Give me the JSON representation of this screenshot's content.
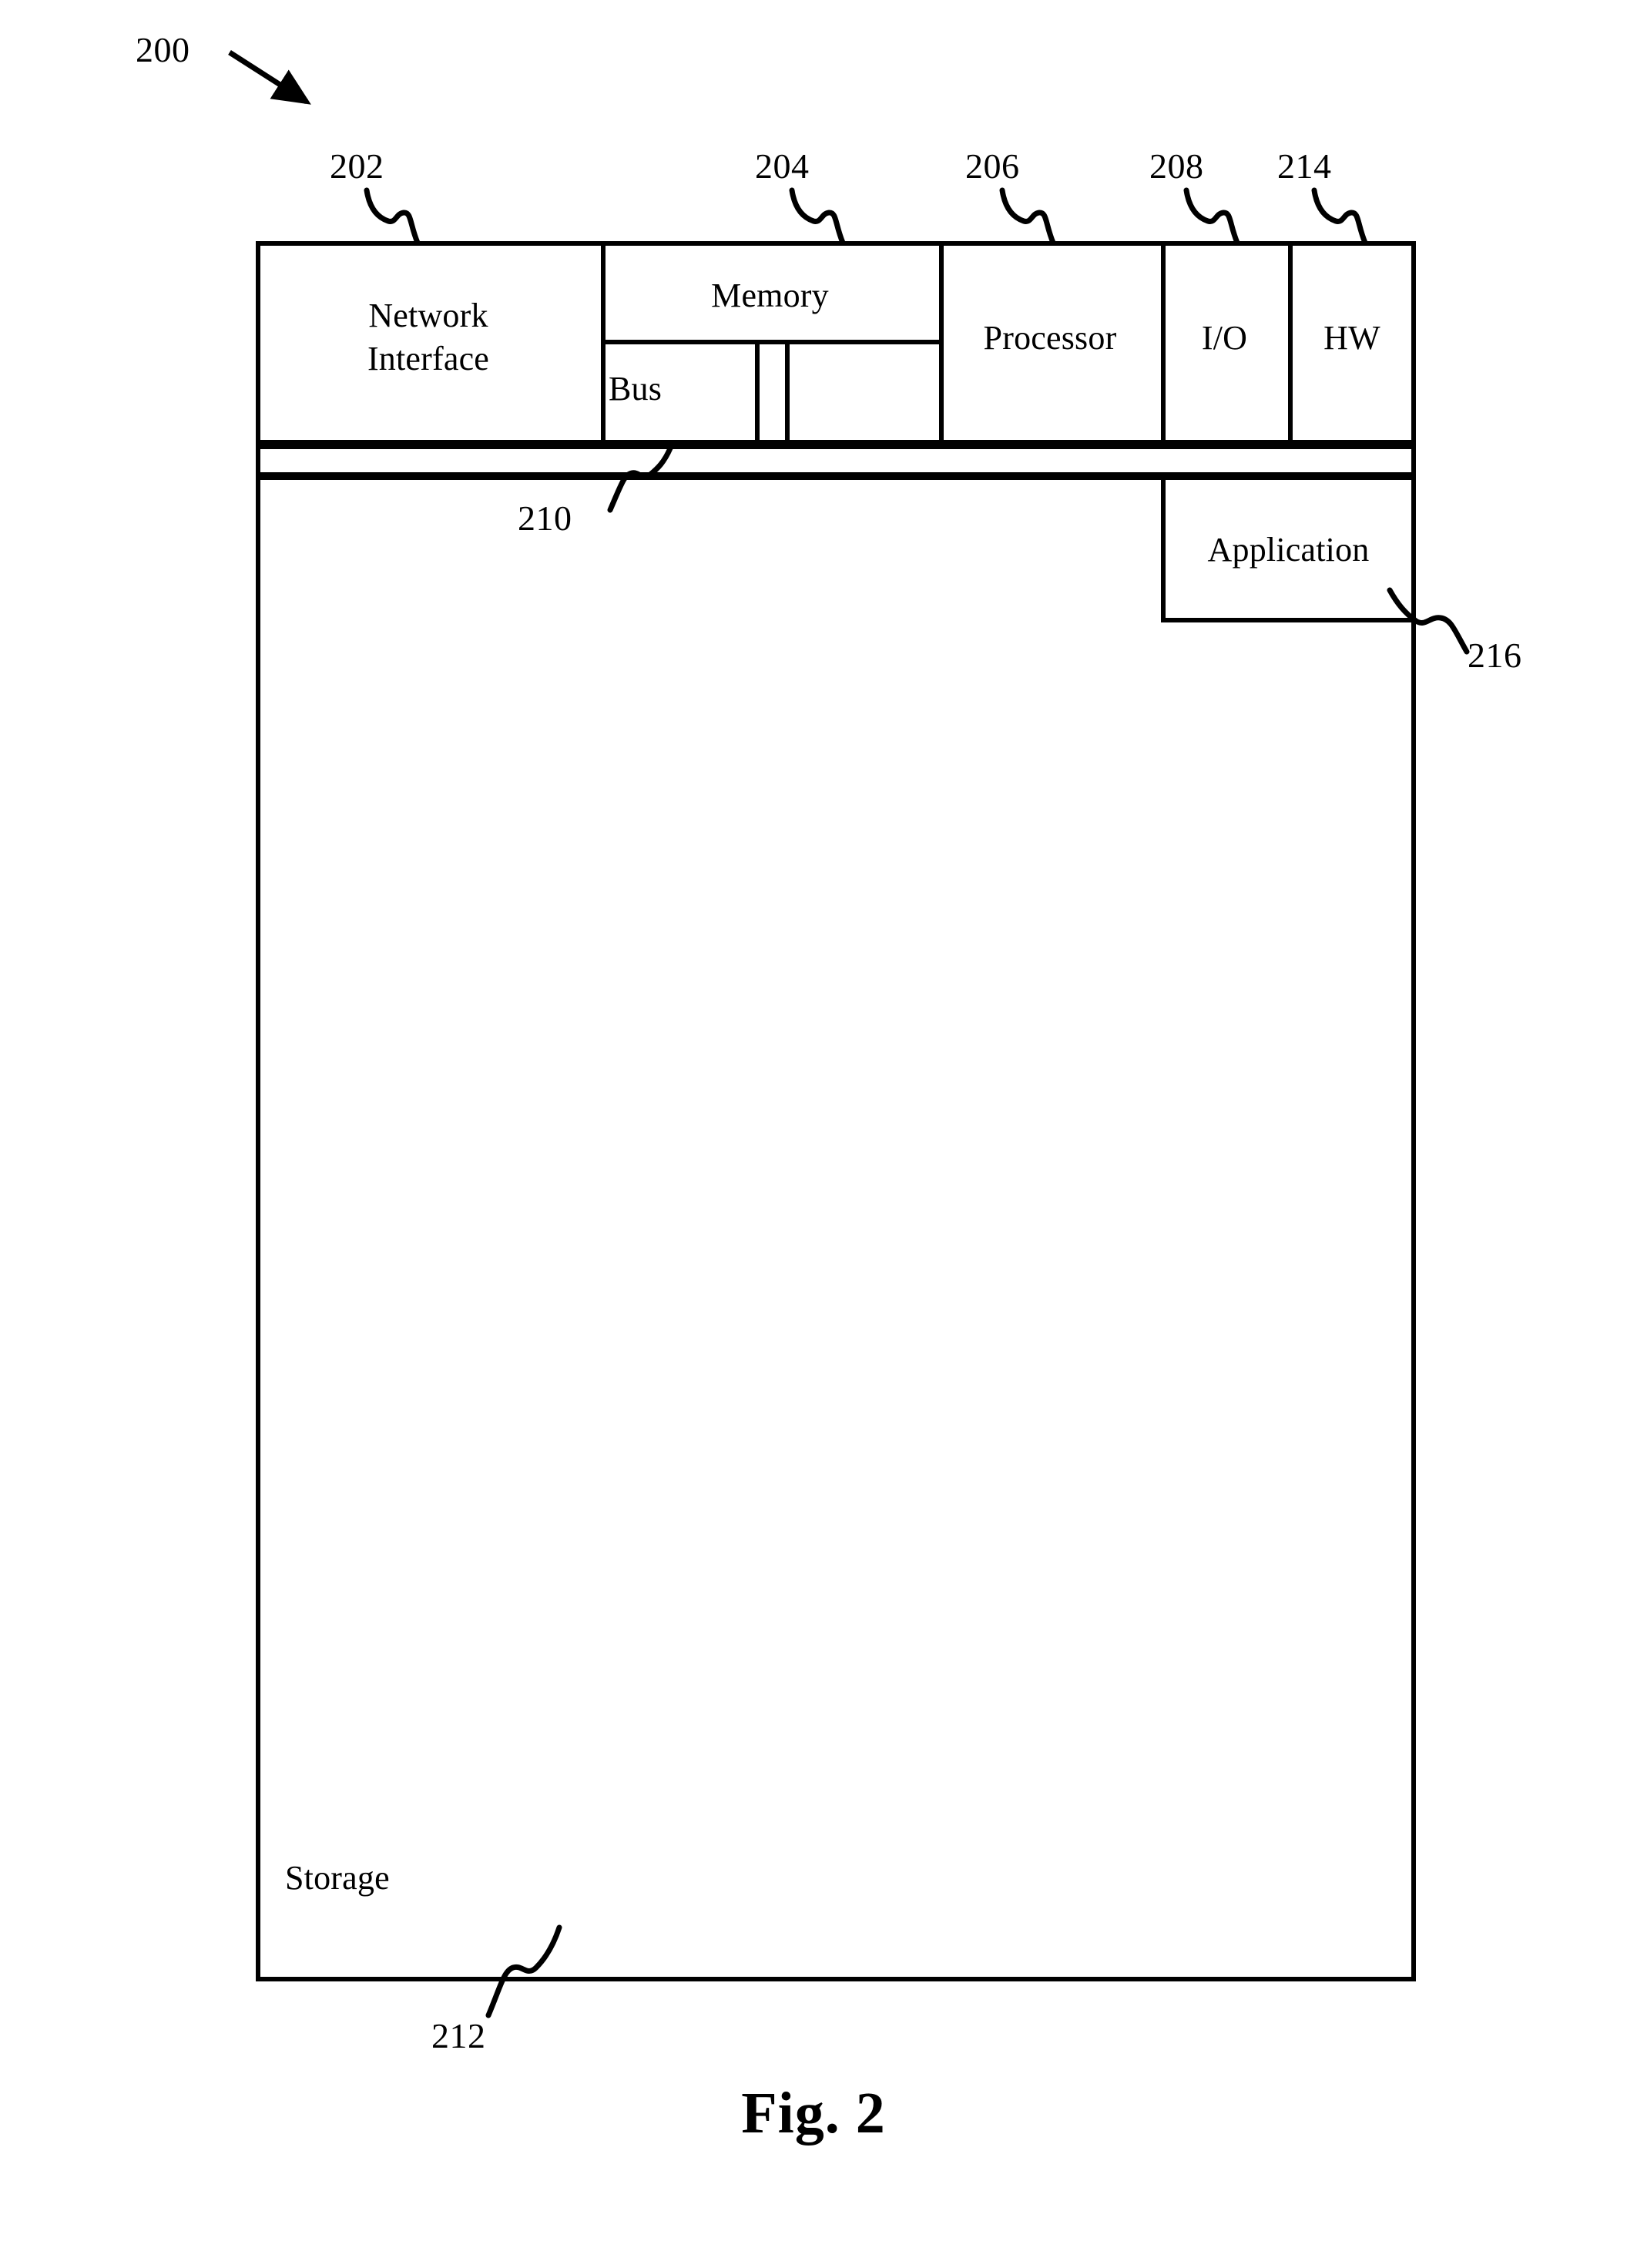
{
  "figure": {
    "caption": "Fig. 2",
    "system_ref": "200"
  },
  "blocks": [
    {
      "id": "network-interface",
      "label": "Network\nInterface",
      "ref": "202"
    },
    {
      "id": "memory",
      "label": "Memory",
      "ref": "204"
    },
    {
      "id": "bus",
      "label": "Bus",
      "ref": ""
    },
    {
      "id": "memory-cell-a",
      "label": "",
      "ref": ""
    },
    {
      "id": "memory-cell-b",
      "label": "",
      "ref": ""
    },
    {
      "id": "processor",
      "label": "Processor",
      "ref": "206"
    },
    {
      "id": "io",
      "label": "I/O",
      "ref": "208"
    },
    {
      "id": "hw",
      "label": "HW",
      "ref": "214"
    },
    {
      "id": "interconnect-bar",
      "label": "",
      "ref": "210"
    },
    {
      "id": "storage",
      "label": "Storage",
      "ref": "212"
    },
    {
      "id": "application",
      "label": "Application",
      "ref": "216"
    }
  ],
  "refs": {
    "system": "200",
    "network_interface": "202",
    "memory": "204",
    "processor": "206",
    "io": "208",
    "hw": "214",
    "interconnect": "210",
    "storage": "212",
    "application": "216"
  },
  "labels": {
    "network_interface": "Network\nInterface",
    "memory": "Memory",
    "bus": "Bus",
    "processor": "Processor",
    "io": "I/O",
    "hw": "HW",
    "storage": "Storage",
    "application": "Application"
  },
  "style": {
    "line_color": "#000000",
    "background": "#ffffff"
  }
}
